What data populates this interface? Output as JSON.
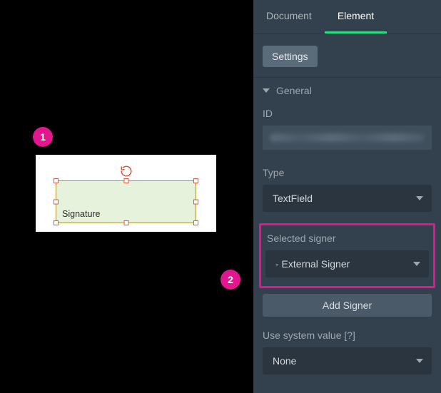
{
  "badges": {
    "one": "1",
    "two": "2"
  },
  "canvas": {
    "signature_label": "Signature"
  },
  "panel": {
    "tabs": {
      "document": "Document",
      "element": "Element"
    },
    "settings_chip": "Settings",
    "general_header": "General",
    "id": {
      "label": "ID"
    },
    "type": {
      "label": "Type",
      "value": "TextField"
    },
    "signer": {
      "label": "Selected signer",
      "value": "- External Signer"
    },
    "add_signer_label": "Add Signer",
    "system_value": {
      "label": "Use system value [?]",
      "value": "None"
    }
  }
}
